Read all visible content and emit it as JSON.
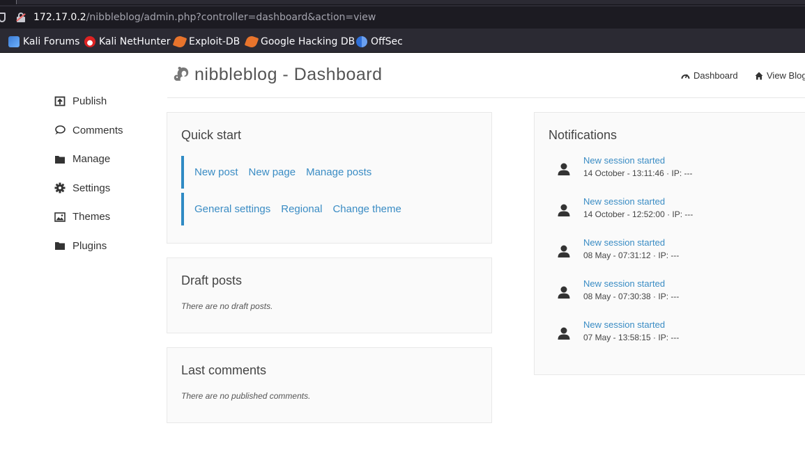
{
  "browser": {
    "url_host": "172.17.0.2",
    "url_path": "/nibbleblog/admin.php?controller=dashboard&action=view",
    "bookmarks": [
      {
        "label": "Kali Forums",
        "icon": "kali-icon"
      },
      {
        "label": "Kali NetHunter",
        "icon": "nethunter-icon"
      },
      {
        "label": "Exploit-DB",
        "icon": "exploit-db-icon"
      },
      {
        "label": "Google Hacking DB",
        "icon": "ghdb-icon"
      },
      {
        "label": "OffSec",
        "icon": "offsec-icon"
      }
    ]
  },
  "header": {
    "title": "nibbleblog - Dashboard",
    "nav": [
      {
        "label": "Dashboard",
        "icon": "dashboard-icon"
      },
      {
        "label": "View Blog",
        "icon": "home-icon"
      }
    ]
  },
  "sidebar": {
    "items": [
      {
        "label": "Publish",
        "icon": "publish-icon"
      },
      {
        "label": "Comments",
        "icon": "comment-icon"
      },
      {
        "label": "Manage",
        "icon": "folder-icon"
      },
      {
        "label": "Settings",
        "icon": "gear-icon"
      },
      {
        "label": "Themes",
        "icon": "image-icon"
      },
      {
        "label": "Plugins",
        "icon": "folder-icon"
      }
    ]
  },
  "quick_start": {
    "title": "Quick start",
    "row1": [
      "New post",
      "New page",
      "Manage posts"
    ],
    "row2": [
      "General settings",
      "Regional",
      "Change theme"
    ]
  },
  "draft_posts": {
    "title": "Draft posts",
    "empty": "There are no draft posts."
  },
  "last_comments": {
    "title": "Last comments",
    "empty": "There are no published comments."
  },
  "notifications": {
    "title": "Notifications",
    "items": [
      {
        "title": "New session started",
        "detail": "14 October - 13:11:46 · IP: ---"
      },
      {
        "title": "New session started",
        "detail": "14 October - 12:52:00 · IP: ---"
      },
      {
        "title": "New session started",
        "detail": "08 May - 07:31:12 · IP: ---"
      },
      {
        "title": "New session started",
        "detail": "08 May - 07:30:38 · IP: ---"
      },
      {
        "title": "New session started",
        "detail": "07 May - 13:58:15 · IP: ---"
      }
    ]
  },
  "colors": {
    "link": "#3a8cc4",
    "accent_bar": "#2f8ac4",
    "browser_bg": "#1c1b22",
    "bookmarks_bg": "#2b2a33"
  }
}
